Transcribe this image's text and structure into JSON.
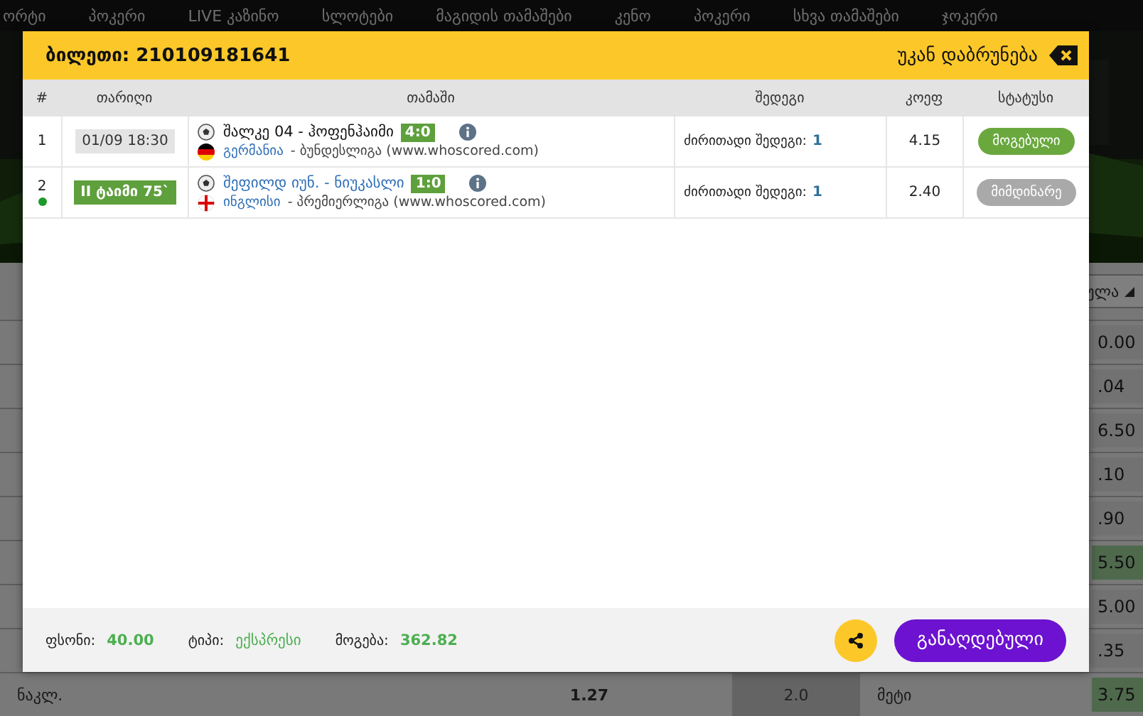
{
  "nav": [
    "ორტი",
    "პოკერი",
    "LIVE კაზინო",
    "სლოტები",
    "მაგიდის თამაშები",
    "კენო",
    "პოკერი",
    "სხვა თამაშები",
    "ჯოკერი"
  ],
  "filter": {
    "value": "ულა"
  },
  "odds_rows": [
    {
      "edge": "0.00",
      "highlight": false
    },
    {
      "edge": ".04",
      "highlight": false
    },
    {
      "edge": "6.50",
      "highlight": false
    },
    {
      "edge": ".10",
      "highlight": false
    },
    {
      "edge": ".90",
      "highlight": false
    },
    {
      "edge": "5.50",
      "highlight": true
    },
    {
      "edge": "5.00",
      "highlight": false
    },
    {
      "edge": ".35",
      "highlight": false
    },
    {
      "over": "ნაკლ.",
      "over_odds": "1.27",
      "line": "2.0",
      "under": "მეტი",
      "edge": "3.75",
      "highlight": true
    }
  ],
  "ticket": {
    "title": "ბილეთი: 210109181641",
    "back": "უკან დაბრუნება"
  },
  "columns": [
    "#",
    "თარიღი",
    "თამაში",
    "შედეგი",
    "კოეფ",
    "სტატუსი"
  ],
  "rows": [
    {
      "number": "1",
      "live": false,
      "time": {
        "text": "01/09 18:30",
        "kind": "scheduled"
      },
      "match": {
        "text": "შალკე 04 - ჰოფენჰაიმი",
        "kind": "plain"
      },
      "score": "4:0",
      "country": "გერმანია",
      "league": "- ბუნდესლიგა (www.whoscored.com)",
      "flag": {
        "kind": "germany"
      },
      "bet_label": "ძირითადი შედეგი:",
      "bet_value": "1",
      "odds": "4.15",
      "status": {
        "text": "მოგებული",
        "kind": "won"
      }
    },
    {
      "number": "2",
      "live": true,
      "time": {
        "text": "II ტაიმი 75`",
        "kind": "live"
      },
      "match": {
        "text": "შეფილდ იუნ. - ნიუკასლი",
        "kind": "link"
      },
      "score": "1:0",
      "country": "ინგლისი",
      "league": "- პრემიერლიგა (www.whoscored.com)",
      "flag": {
        "kind": "england"
      },
      "bet_label": "ძირითადი შედეგი:",
      "bet_value": "1",
      "odds": "2.40",
      "status": {
        "text": "მიმდინარე",
        "kind": "pending"
      }
    }
  ],
  "footer": {
    "stake_label": "ფსონი:",
    "stake": "40.00",
    "type_label": "ტიპი:",
    "type": "ექსპრესი",
    "win_label": "მოგება:",
    "win": "362.82",
    "button": "განაღდებული"
  }
}
